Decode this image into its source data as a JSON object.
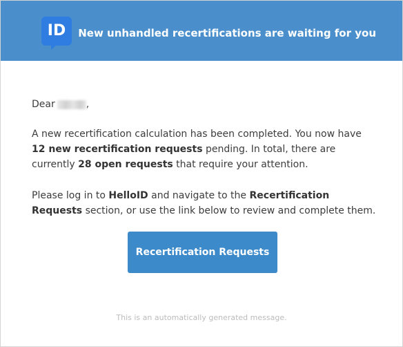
{
  "header": {
    "logo_text": "ID",
    "title": "New unhandled recertifications are waiting for you"
  },
  "greeting": {
    "prefix": "Dear",
    "suffix": ","
  },
  "paragraph1": {
    "t1": "A new recertification calculation has been completed. You now have ",
    "b1": "12 new recertification requests",
    "t2": " pending. In total, there are currently ",
    "b2": "28 open requests",
    "t3": " that require your attention."
  },
  "paragraph2": {
    "t1": "Please log in to ",
    "b1": "HelloID",
    "t2": " and navigate to the ",
    "b2": "Recertification Requests",
    "t3": " section, or use the link below to review and complete them."
  },
  "cta": {
    "label": "Recertification Requests"
  },
  "footer": {
    "text": "This is an automatically generated message."
  },
  "colors": {
    "header_bg": "#4a8fcc",
    "logo_bg": "#2f7de1",
    "button_bg": "#3d8acb"
  }
}
